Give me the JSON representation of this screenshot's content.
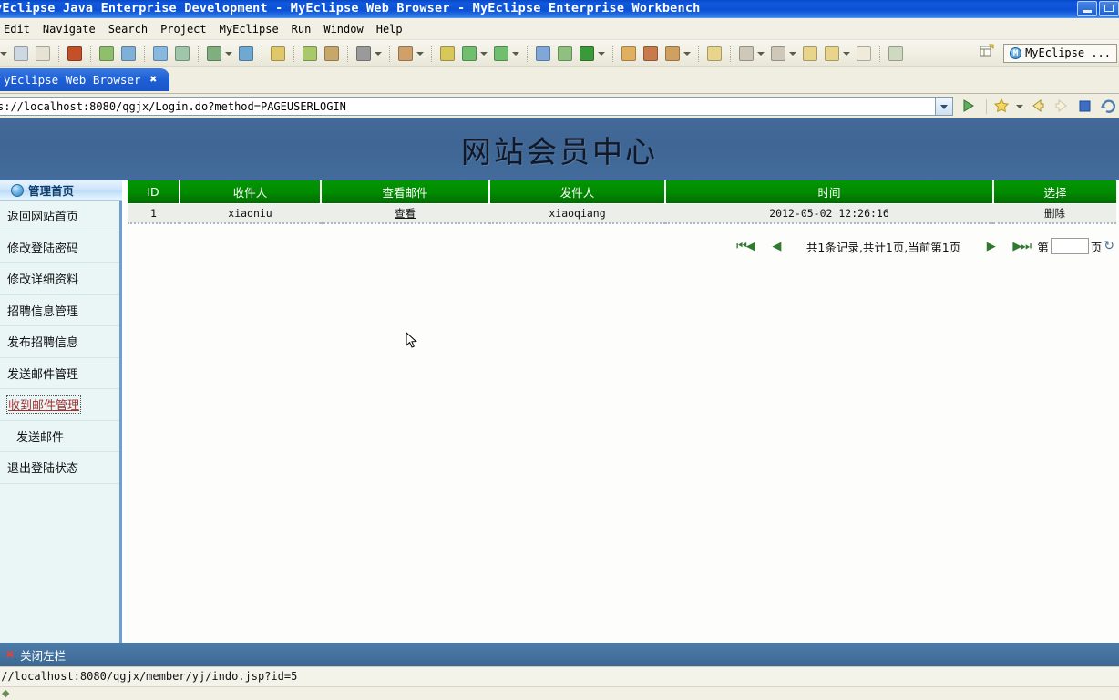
{
  "window": {
    "title": "yEclipse Java Enterprise Development - MyEclipse Web Browser - MyEclipse Enterprise Workbench",
    "minimize_label": "_",
    "restore_label": "[]"
  },
  "menubar": {
    "items": [
      "Edit",
      "Navigate",
      "Search",
      "Project",
      "MyEclipse",
      "Run",
      "Window",
      "Help"
    ]
  },
  "toolbar": {
    "perspective_label": "MyEclipse ...",
    "perspective_badge": "M",
    "icons": [
      "save-icon",
      "print-icon",
      "package-icon",
      "new-wizard-icon",
      "ejb-2-icon",
      "deploy-icon",
      "undeploy-icon",
      "server-config-icon",
      "run-server-icon",
      "browser-icon",
      "open-type-icon",
      "new-class-icon",
      "camera-icon",
      "edit-icon",
      "debug-icon",
      "run-icon",
      "profile-icon",
      "export-icon",
      "new-project-icon",
      "refresh-icon",
      "open-folder-icon",
      "search-icon",
      "open-resource-icon",
      "bookmark-icon",
      "previous-annotation-icon",
      "next-annotation-icon",
      "last-edit-icon",
      "back-icon",
      "forward-icon",
      "open-perspective-icon"
    ]
  },
  "browser_tab": {
    "label": "yEclipse Web Browser",
    "close_label": "✖"
  },
  "address_bar": {
    "url": "s://localhost:8080/qgjx/Login.do?method=PAGEUSERLOGIN",
    "go_label": "▶",
    "buttons": [
      "bookmarks-icon",
      "dropdown-arrow-icon",
      "back-icon",
      "forward-icon",
      "stop-icon",
      "refresh-icon"
    ]
  },
  "page": {
    "banner_title": "网站会员中心",
    "sidebar": {
      "header": "管理首页",
      "items": [
        {
          "label": "返回网站首页",
          "active": false,
          "indent": false
        },
        {
          "label": "修改登陆密码",
          "active": false,
          "indent": false
        },
        {
          "label": "修改详细资料",
          "active": false,
          "indent": false
        },
        {
          "label": "招聘信息管理",
          "active": false,
          "indent": false
        },
        {
          "label": "发布招聘信息",
          "active": false,
          "indent": false
        },
        {
          "label": "发送邮件管理",
          "active": false,
          "indent": false
        },
        {
          "label": "收到邮件管理",
          "active": true,
          "indent": false
        },
        {
          "label": "发送邮件",
          "active": false,
          "indent": true
        },
        {
          "label": "退出登陆状态",
          "active": false,
          "indent": false
        }
      ]
    },
    "table": {
      "headers": [
        "ID",
        "收件人",
        "查看邮件",
        "发件人",
        "时间",
        "选择"
      ],
      "rows": [
        {
          "id": "1",
          "recipient": "xiaoniu",
          "view": "查看",
          "sender": "xiaoqiang",
          "time": "2012-05-02 12:26:16",
          "action": "删除"
        }
      ]
    },
    "pager": {
      "first_label": "⏮◀",
      "prev_label": "◀",
      "summary": "共1条记录,共计1页,当前第1页",
      "next_label": "▶",
      "last_label": "▶⏭",
      "goto_prefix": "第",
      "goto_value": "",
      "goto_suffix": "页",
      "refresh_label": "↻"
    }
  },
  "bottom": {
    "close_panel_label": "关闭左栏",
    "close_icon": "✖",
    "status_url": "://localhost:8080/qgjx/member/yj/indo.jsp?id=5"
  },
  "colors": {
    "title_blue": "#0b4fd4",
    "banner_blue": "#3f6694",
    "table_header_green": "#018a01",
    "sidebar_bg": "#e9f6f5",
    "active_link_red": "#a33232"
  }
}
